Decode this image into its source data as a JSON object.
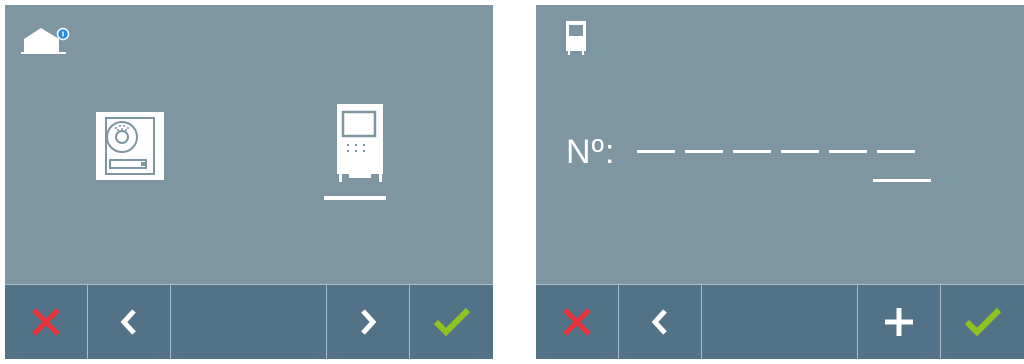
{
  "left_screen": {
    "header_icon": "home-notification-icon",
    "options": [
      {
        "icon": "door-panel-icon",
        "selected": false
      },
      {
        "icon": "indoor-monitor-icon",
        "selected": true
      }
    ],
    "footer": [
      {
        "icon": "cancel-x-icon",
        "color": "#e8323c"
      },
      {
        "icon": "chevron-left-icon",
        "color": "#ffffff"
      },
      {
        "icon": "empty"
      },
      {
        "icon": "chevron-right-icon",
        "color": "#ffffff"
      },
      {
        "icon": "check-icon",
        "color": "#8fc31f"
      }
    ]
  },
  "right_screen": {
    "header_icon": "indoor-monitor-icon",
    "number_label": "Nº:",
    "digit_slots": 6,
    "active_slot": 6,
    "footer": [
      {
        "icon": "cancel-x-icon",
        "color": "#e8323c"
      },
      {
        "icon": "chevron-left-icon",
        "color": "#ffffff"
      },
      {
        "icon": "empty"
      },
      {
        "icon": "plus-icon",
        "color": "#ffffff"
      },
      {
        "icon": "check-icon",
        "color": "#8fc31f"
      }
    ]
  },
  "colors": {
    "screen_bg": "#7d96a1",
    "footer_bg": "#527387",
    "divider": "#a9bcc6",
    "cancel": "#e8323c",
    "confirm": "#8fc31f"
  }
}
